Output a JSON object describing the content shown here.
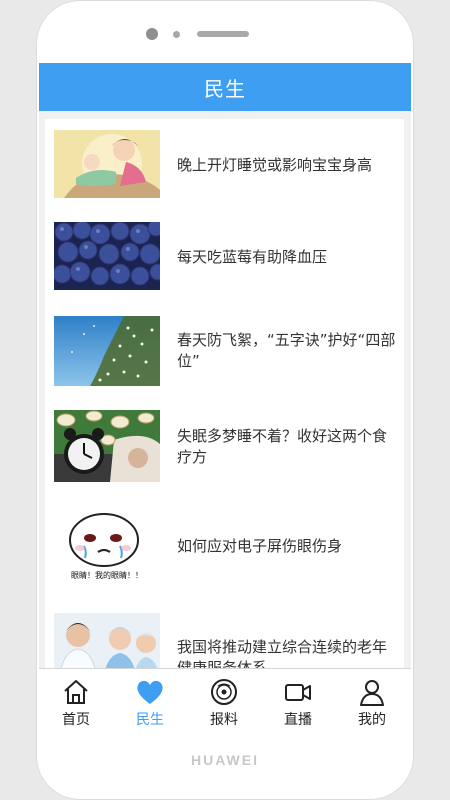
{
  "header": {
    "title": "民生"
  },
  "news": [
    {
      "title": "晚上开灯睡觉或影响宝宝身高",
      "image": "mother-baby-sleeping"
    },
    {
      "title": "每天吃蓝莓有助降血压",
      "image": "blueberries"
    },
    {
      "title": "春天防飞絮，“五字诀”护好“四部位”",
      "image": "catkins-sky"
    },
    {
      "title": "失眠多梦睡不着？收好这两个食疗方",
      "image": "alarm-clock-sheep"
    },
    {
      "title": "如何应对电子屏伤眼伤身",
      "image": "crying-face-sticker",
      "sticker_text": "眼睛！我的眼睛！！"
    },
    {
      "title": "我国将推动建立综合连续的老年健康服务体系",
      "image": "elderly-couple-doctor"
    }
  ],
  "tabs": [
    {
      "label": "首页",
      "icon": "home-icon",
      "active": false
    },
    {
      "label": "民生",
      "icon": "heart-icon",
      "active": true
    },
    {
      "label": "报料",
      "icon": "disc-icon",
      "active": false
    },
    {
      "label": "直播",
      "icon": "video-camera-icon",
      "active": false
    },
    {
      "label": "我的",
      "icon": "user-icon",
      "active": false
    }
  ],
  "colors": {
    "accent": "#3d9ef2",
    "tab_inactive": "#222222"
  },
  "device": {
    "brand": "HUAWEI"
  }
}
